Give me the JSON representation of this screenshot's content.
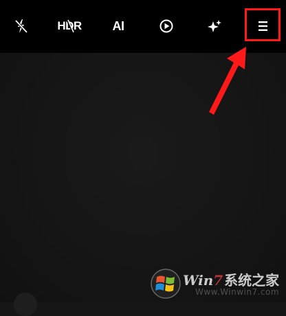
{
  "toolbar": {
    "hdr_label": "HDR",
    "ai_label": "AI"
  },
  "icons": {
    "flash": "flash-off-icon",
    "hdr": "hdr-off-icon",
    "ai": "ai-icon",
    "live": "live-play-icon",
    "filter": "sparkle-filter-icon",
    "menu": "hamburger-menu-icon"
  },
  "annotation": {
    "color": "#ff1a1a"
  },
  "watermark": {
    "brand_win": "Win",
    "brand_seven": "7",
    "brand_rest": "系统之家",
    "url": "Www.Winwin7.com"
  }
}
